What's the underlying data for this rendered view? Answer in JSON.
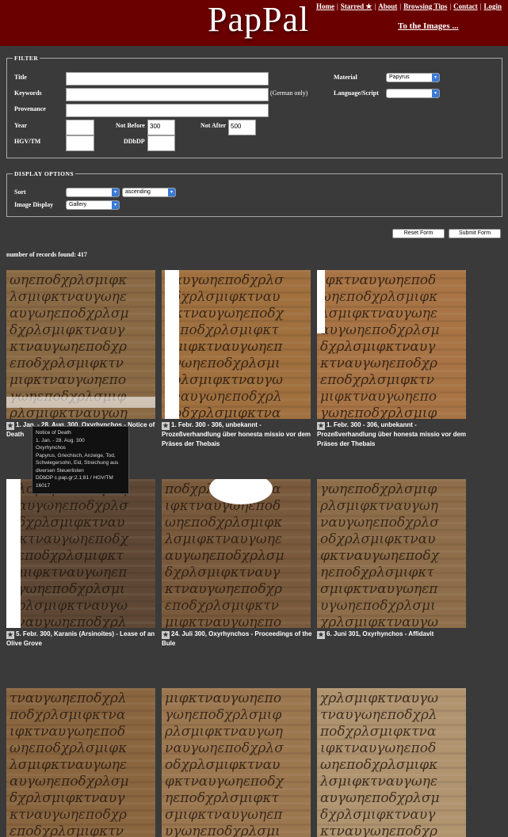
{
  "header": {
    "logo": "PapPal",
    "nav": [
      "Home",
      "Starred ★",
      "About",
      "Browsing Tips",
      "Contact",
      "Login"
    ],
    "to_images": "To the Images ..."
  },
  "filter": {
    "legend": "Filter",
    "title_label": "Title",
    "keywords_label": "Keywords",
    "keywords_note": "(German only)",
    "provenance_label": "Provenance",
    "year_label": "Year",
    "not_before_label": "Not Before",
    "not_before_value": "300",
    "not_after_label": "Not After",
    "not_after_value": "500",
    "hgv_label": "HGV/TM",
    "ddbdp_label": "DDbDP",
    "material_label": "Material",
    "material_value": "Papyrus",
    "language_label": "Language/Script",
    "language_value": ""
  },
  "display": {
    "legend": "Display options",
    "sort_label": "Sort",
    "sort_value": "",
    "order_value": "ascending",
    "image_display_label": "Image Display",
    "image_display_value": "Gallery"
  },
  "buttons": {
    "reset": "Reset Form",
    "submit": "Submit Form"
  },
  "results": {
    "count_text": "number of records found: 417",
    "items": [
      {
        "caption": "1. Jan. - 28. Aug. 300, Oxyrhynchos - Notice of Death",
        "tone": "#8a6a45"
      },
      {
        "caption": "1. Febr. 300 - 306, unbekannt - Prozeßverhandlung über honesta missio vor dem Präses der Thebais",
        "tone": "#a0703f"
      },
      {
        "caption": "1. Febr. 300 - 306, unbekannt - Prozeßverhandlung über honesta missio vor dem Präses der Thebais",
        "tone": "#a87445"
      },
      {
        "caption": "5. Febr. 300, Karanis (Arsinoites) - Lease of an Olive Grove",
        "tone": "#5e4835"
      },
      {
        "caption": "24. Juli 300, Oxyrhynchos - Proceedings of the Bule",
        "tone": "#7a5a3c"
      },
      {
        "caption": "6. Juni 301, Oxyrhynchos - Affidavit",
        "tone": "#8e6e4a"
      },
      {
        "caption": "",
        "tone": "#8a6640"
      },
      {
        "caption": "",
        "tone": "#9b7750"
      },
      {
        "caption": "",
        "tone": "#b09470"
      }
    ]
  },
  "tooltip": {
    "title": "Notice of Death",
    "date": "1. Jan. - 28. Aug. 300",
    "place": "Oxyrhynchos",
    "keywords": "Papyrus, Griechisch, Anzeige, Tod, Schwiegersohn, Eid, Streichung aus diversen Steuerlisten",
    "ids": "DDbDP c.pap.gr;2.1;81 / HGV/TM 16017"
  }
}
